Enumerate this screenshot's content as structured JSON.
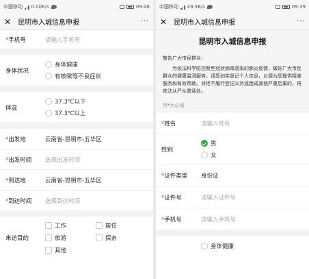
{
  "left": {
    "status": {
      "carrier": "中国移动",
      "network_speed": "0.00K/s",
      "time": "09:48"
    },
    "nav": {
      "title": "昆明市入城信息申报",
      "more": "···"
    },
    "form": {
      "phone_label": "手机号",
      "phone_placeholder": "请输入手机号",
      "health_label": "身体状况",
      "health_options": [
        "身体健康",
        "有咳嗽等不良症状"
      ],
      "temp_label": "体温",
      "temp_options": [
        "37.3℃以下",
        "37.3℃以上"
      ],
      "origin_label": "出发地",
      "origin_value": "云南省-昆明市-五华区",
      "depart_time_label": "出发时间",
      "depart_time_placeholder": "选择出发时间",
      "dest_label": "到达地",
      "dest_value": "云南省-昆明市-五华区",
      "arrive_time_label": "到达时间",
      "arrive_time_placeholder": "选择到达时间",
      "purpose_label": "来访目的",
      "purpose_options": [
        "工作",
        "居住",
        "旅游",
        "探亲",
        "其他"
      ]
    }
  },
  "right": {
    "status": {
      "carrier": "中国移动",
      "network_speed": "49.3B/s",
      "time": "09:39"
    },
    "nav": {
      "title": "昆明市入城信息申报",
      "more": "···"
    },
    "header": {
      "title": "昆明市入城信息申报",
      "greeting": "敬告广大市民群众：",
      "notice": "为依法科学防控新型冠状病毒感染的肺炎疫情，做好广大市民群众的健康监测服务，请您如实登记个人信息，以便为您提供精准服务和有效帮助。对拒不履行登记义务或造成其他严重后果的，将依法从严从重惩处。",
      "required_note_prefix": "带",
      "required_note_suffix": "为必填"
    },
    "form": {
      "name_label": "姓名",
      "name_placeholder": "请输入姓名",
      "gender_label": "性别",
      "gender_options": [
        "男",
        "女"
      ],
      "gender_selected": "男",
      "id_type_label": "证件类型",
      "id_type_value": "身份证",
      "id_no_label": "证件号",
      "id_no_placeholder": "请输入证件号",
      "phone_label": "手机号",
      "phone_placeholder": "请输入手机号",
      "health_option_partial": "身体健康"
    }
  },
  "colors": {
    "required": "#e0453a",
    "checked": "#2fa84f"
  }
}
